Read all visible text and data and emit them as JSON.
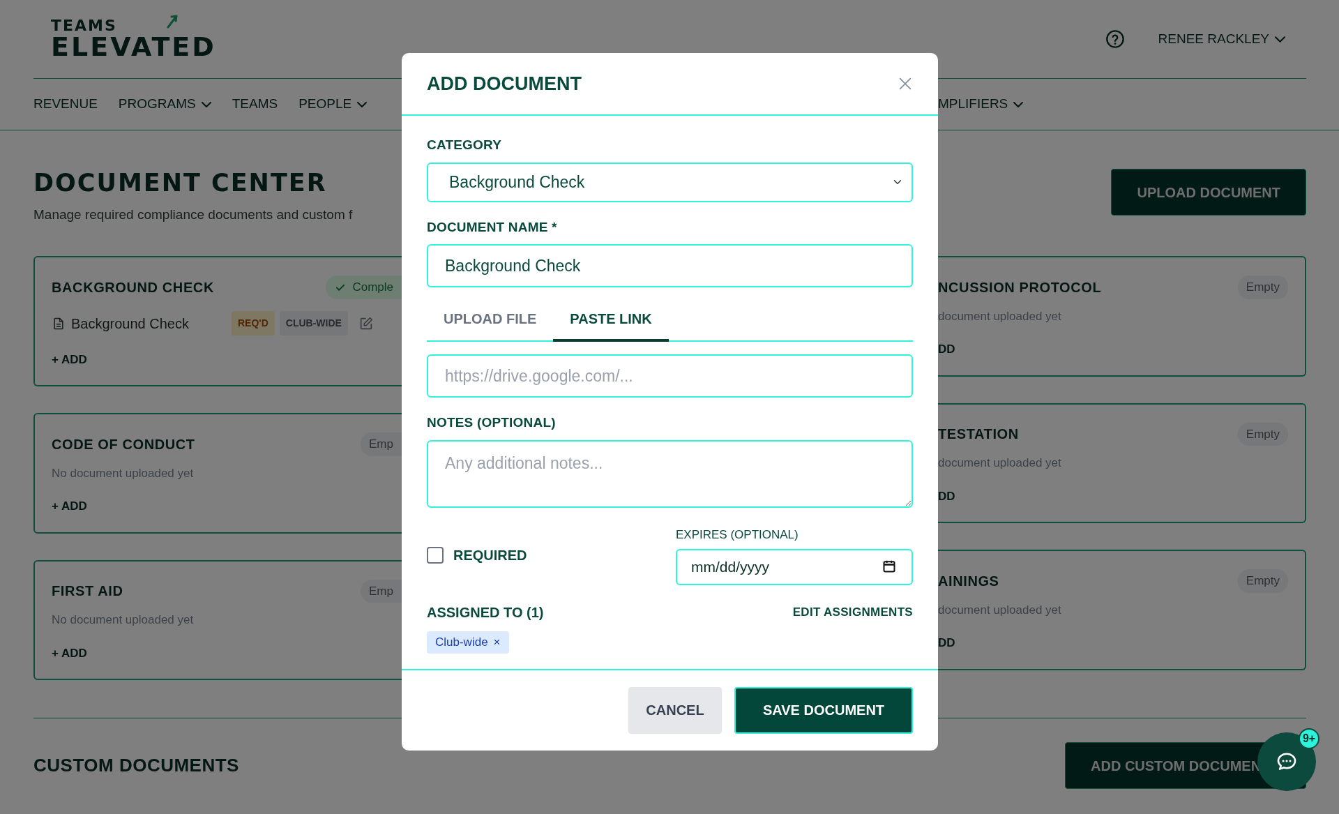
{
  "logo": {
    "line_1": "TEAMS",
    "line_2": "ELEVATED"
  },
  "user_menu": {
    "name": "RENEE RACKLEY"
  },
  "nav": {
    "left": [
      {
        "label": "REVENUE",
        "dropdown": false
      },
      {
        "label": "PROGRAMS",
        "dropdown": true
      },
      {
        "label": "TEAMS",
        "dropdown": false
      },
      {
        "label": "PEOPLE",
        "dropdown": true
      }
    ],
    "right": [
      {
        "label": "MPLIFIERS",
        "dropdown": true
      }
    ]
  },
  "page": {
    "title": "DOCUMENT CENTER",
    "subtitle": "Manage required compliance documents and custom f",
    "upload_button": "UPLOAD DOCUMENT"
  },
  "left_cards": [
    {
      "title": "BACKGROUND CHECK",
      "status": "Comple",
      "complete": true,
      "documents": [
        {
          "name": "Background Check",
          "tags": [
            {
              "label": "REQ'D",
              "kind": "required"
            },
            {
              "label": "CLUB-WIDE",
              "kind": "scope"
            }
          ]
        }
      ],
      "add": "+ ADD"
    },
    {
      "title": "CODE OF CONDUCT",
      "status": "Emp",
      "complete": false,
      "empty_text": "No document uploaded yet",
      "add": "+ ADD"
    },
    {
      "title": "FIRST AID",
      "status": "Emp",
      "complete": false,
      "empty_text": "No document uploaded yet",
      "add": "+ ADD"
    }
  ],
  "right_cards": [
    {
      "title": "NCUSSION PROTOCOL",
      "status": "Empty",
      "complete": false,
      "empty_text": "document uploaded yet",
      "add": "DD"
    },
    {
      "title": "TESTATION",
      "status": "Empty",
      "complete": false,
      "empty_text": "document uploaded yet",
      "add": "DD"
    },
    {
      "title": "AININGS",
      "status": "Empty",
      "complete": false,
      "empty_text": "document uploaded yet",
      "add": "DD"
    }
  ],
  "section": {
    "title": "CUSTOM DOCUMENTS",
    "button": "ADD CUSTOM DOCUMEN"
  },
  "chat": {
    "badge": "9+"
  },
  "modal": {
    "title": "ADD DOCUMENT",
    "category": {
      "label": "CATEGORY",
      "value": "Background Check"
    },
    "document_name": {
      "label": "DOCUMENT NAME *",
      "value": "Background Check"
    },
    "tabs": [
      {
        "label": "UPLOAD FILE",
        "selected": false
      },
      {
        "label": "PASTE LINK",
        "selected": true
      }
    ],
    "link_field": {
      "placeholder": "https://drive.google.com/..."
    },
    "notes": {
      "label": "NOTES (OPTIONAL)",
      "placeholder": "Any additional notes..."
    },
    "required": {
      "label": "REQUIRED",
      "checked": false
    },
    "expires": {
      "label": "EXPIRES (OPTIONAL)",
      "placeholder": "mm/dd/yyyy"
    },
    "assigned": {
      "label": "ASSIGNED TO (1)",
      "action": "EDIT ASSIGNMENTS",
      "chips": [
        {
          "label": "Club-wide",
          "remove": "×"
        }
      ]
    },
    "buttons": {
      "cancel": "CANCEL",
      "save": "SAVE DOCUMENT"
    }
  }
}
